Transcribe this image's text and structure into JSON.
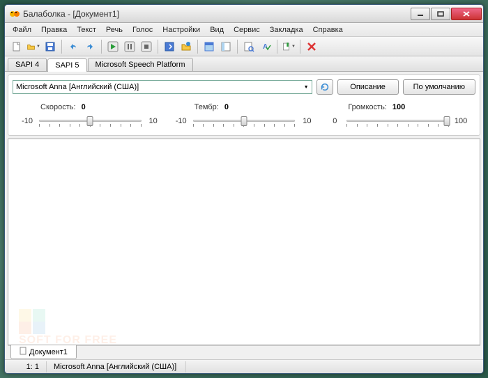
{
  "app": {
    "title": "Балаболка - [Документ1]",
    "icon": "balabolka-icon"
  },
  "menu": {
    "items": [
      "Файл",
      "Правка",
      "Текст",
      "Речь",
      "Голос",
      "Настройки",
      "Вид",
      "Сервис",
      "Закладка",
      "Справка"
    ]
  },
  "tabs": {
    "items": [
      "SAPI 4",
      "SAPI 5",
      "Microsoft Speech Platform"
    ],
    "active_index": 1
  },
  "voice": {
    "selected": "Microsoft Anna [Английский (США)]",
    "buttons": {
      "refresh": "refresh",
      "description": "Описание",
      "default": "По умолчанию"
    }
  },
  "sliders": {
    "speed": {
      "label": "Скорость:",
      "value": "0",
      "min": "-10",
      "max": "10",
      "pos": 50
    },
    "pitch": {
      "label": "Тембр:",
      "value": "0",
      "min": "-10",
      "max": "10",
      "pos": 50
    },
    "volume": {
      "label": "Громкость:",
      "value": "100",
      "min": "0",
      "max": "100",
      "pos": 98
    }
  },
  "doc_tabs": {
    "items": [
      "Документ1"
    ]
  },
  "statusbar": {
    "position": "1:  1",
    "voice": "Microsoft Anna [Английский (США)]"
  },
  "watermark": "SOFT FOR FREE"
}
